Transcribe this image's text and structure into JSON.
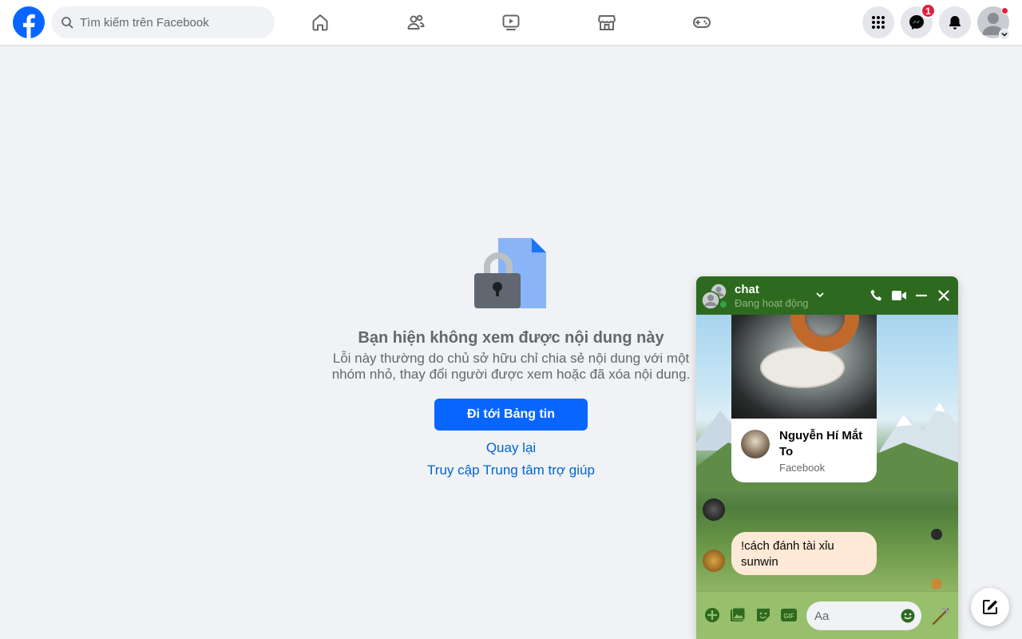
{
  "topbar": {
    "search_placeholder": "Tìm kiếm trên Facebook",
    "messenger_badge": "1",
    "nav_icons": [
      "home-icon",
      "friends-icon",
      "video-icon",
      "marketplace-icon",
      "gaming-icon"
    ],
    "right_icons": [
      "menu-grid-icon",
      "messenger-icon",
      "notifications-icon",
      "account-avatar"
    ]
  },
  "content": {
    "title": "Bạn hiện không xem được nội dung này",
    "description": "Lỗi này thường do chủ sở hữu chỉ chia sẻ nội dung với một nhóm nhỏ, thay đổi người được xem hoặc đã xóa nội dung.",
    "primary_button": "Đi tới Bảng tin",
    "back_link": "Quay lại",
    "help_link": "Truy cập Trung tâm trợ giúp"
  },
  "chat": {
    "title": "chat",
    "status": "Đang hoạt động",
    "shared_post": {
      "name": "Nguyễn Hí Mắt To",
      "source": "Facebook"
    },
    "message": "!cách đánh tài xỉu sunwin",
    "input_placeholder": "Aa",
    "footer_icons": [
      "add-icon",
      "image-icon",
      "sticker-icon",
      "gif-icon",
      "emoji-icon",
      "thumb-icon"
    ]
  },
  "colors": {
    "facebook_blue": "#0866ff",
    "link_blue": "#0064d1",
    "chat_header": "#2d6a1f",
    "chat_footer": "#98bf6b",
    "badge_red": "#e41e3f"
  }
}
